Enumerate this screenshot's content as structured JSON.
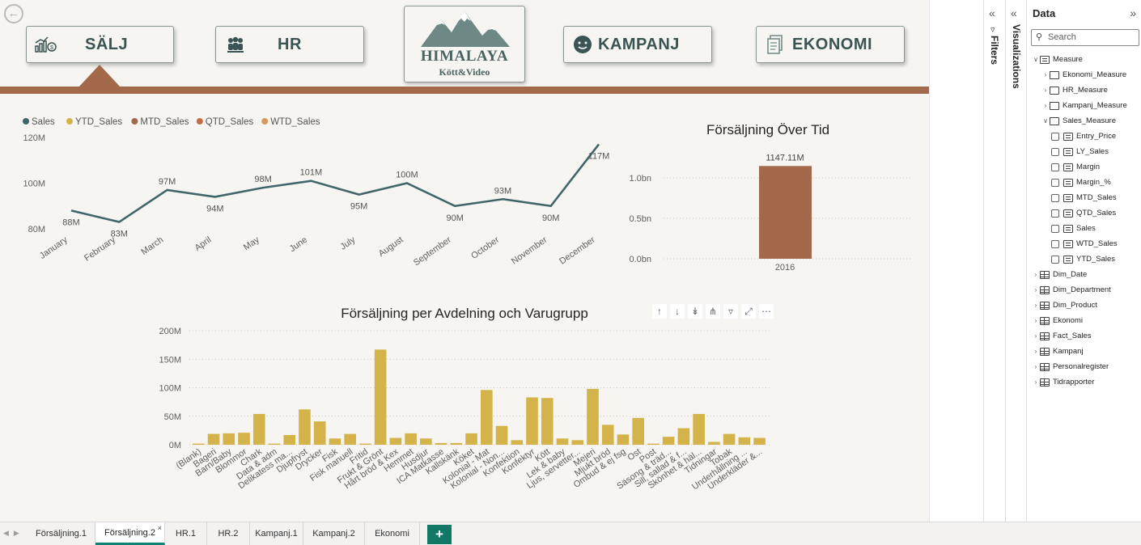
{
  "nav": {
    "salj": "SÄLJ",
    "hr": "HR",
    "kampanj": "KAMPANJ",
    "ekonomi": "EKONOMI"
  },
  "logo": {
    "name": "HIMALAYA",
    "subtitle": "Kött&Video"
  },
  "colors": {
    "accent": "#a4694a",
    "line": "#41666a",
    "bar": "#d4b44a",
    "tab_active": "#118174"
  },
  "legend": [
    {
      "name": "Sales",
      "color": "#41666a"
    },
    {
      "name": "YTD_Sales",
      "color": "#d4b44a"
    },
    {
      "name": "MTD_Sales",
      "color": "#a4694a"
    },
    {
      "name": "QTD_Sales",
      "color": "#c66b45"
    },
    {
      "name": "WTD_Sales",
      "color": "#d39b64"
    }
  ],
  "chart_data": [
    {
      "type": "line",
      "title": "",
      "categories": [
        "January",
        "February",
        "March",
        "April",
        "May",
        "June",
        "July",
        "August",
        "September",
        "October",
        "November",
        "December"
      ],
      "series": [
        {
          "name": "Sales",
          "values": [
            88,
            83,
            97,
            94,
            98,
            101,
            95,
            100,
            90,
            93,
            90,
            117
          ]
        }
      ],
      "data_labels": [
        "88M",
        "83M",
        "97M",
        "94M",
        "98M",
        "101M",
        "95M",
        "100M",
        "90M",
        "93M",
        "90M",
        "117M"
      ],
      "y_ticks": [
        "80M",
        "100M",
        "120M"
      ],
      "ylim": [
        80,
        120
      ],
      "unit": "M"
    },
    {
      "type": "bar",
      "title": "Försäljning Över Tid",
      "categories": [
        "2016"
      ],
      "values": [
        1147.11
      ],
      "data_labels": [
        "1147.11M"
      ],
      "y_ticks": [
        "0.0bn",
        "0.5bn",
        "1.0bn"
      ],
      "ylim": [
        0,
        1.2
      ],
      "unit": "bn"
    },
    {
      "type": "bar",
      "title": "Försäljning per Avdelning och Varugrupp",
      "categories": [
        "(Blank)",
        "Bageri",
        "Barn/Baby",
        "Blommor",
        "Chark",
        "Data & adm",
        "Delikatess ma...",
        "Djupfryst",
        "Drycker",
        "Fisk",
        "Fisk manuell",
        "Fritid",
        "Frukt & Grönt",
        "Hårt bröd & Kex",
        "Hemmet",
        "Husdjur",
        "ICA Matkasse",
        "Kallskänk",
        "Köket",
        "Kolonial - Mat",
        "Kolonial - Non...",
        "Konfektion",
        "Konfektyr",
        "Kött",
        "Lek & baby",
        "Ljus, servetter...",
        "Mejeri",
        "Mjukt bröd",
        "Ombud & ej fsg",
        "Ost",
        "Post",
        "Säsong & träd...",
        "Sill, sallad & f...",
        "Skönhet & häl...",
        "Tidningar",
        "Tobak",
        "Underhållning ...",
        "Underkläder &..."
      ],
      "values": [
        2,
        19,
        20,
        21,
        54,
        2,
        17,
        62,
        41,
        11,
        19,
        2,
        167,
        12,
        20,
        11,
        3,
        3,
        20,
        96,
        33,
        8,
        83,
        82,
        11,
        8,
        98,
        35,
        18,
        47,
        2,
        14,
        29,
        54,
        5,
        19,
        13,
        12
      ],
      "y_ticks": [
        "0M",
        "50M",
        "100M",
        "150M",
        "200M"
      ],
      "ylim": [
        0,
        200
      ],
      "unit": "M"
    }
  ],
  "pane": {
    "filters": "Filters",
    "visualizations": "Visualizations",
    "data_title": "Data",
    "search_placeholder": "Search",
    "tree": [
      {
        "label": "Measure",
        "level": 0,
        "caret": "open",
        "icon": "calc"
      },
      {
        "label": "Ekonomi_Measure",
        "level": 1,
        "caret": "closed",
        "icon": "folder"
      },
      {
        "label": "HR_Measure",
        "level": 1,
        "caret": "closed",
        "icon": "folder"
      },
      {
        "label": "Kampanj_Measure",
        "level": 1,
        "caret": "closed",
        "icon": "folder"
      },
      {
        "label": "Sales_Measure",
        "level": 1,
        "caret": "open",
        "icon": "folder"
      },
      {
        "label": "Entry_Price",
        "level": 2,
        "caret": "none",
        "icon": "calc"
      },
      {
        "label": "LY_Sales",
        "level": 2,
        "caret": "none",
        "icon": "calc"
      },
      {
        "label": "Margin",
        "level": 2,
        "caret": "none",
        "icon": "calc"
      },
      {
        "label": "Margin_%",
        "level": 2,
        "caret": "none",
        "icon": "calc"
      },
      {
        "label": "MTD_Sales",
        "level": 2,
        "caret": "none",
        "icon": "calc"
      },
      {
        "label": "QTD_Sales",
        "level": 2,
        "caret": "none",
        "icon": "calc"
      },
      {
        "label": "Sales",
        "level": 2,
        "caret": "none",
        "icon": "calc"
      },
      {
        "label": "WTD_Sales",
        "level": 2,
        "caret": "none",
        "icon": "calc"
      },
      {
        "label": "YTD_Sales",
        "level": 2,
        "caret": "none",
        "icon": "calc"
      },
      {
        "label": "Dim_Date",
        "level": 0,
        "caret": "closed",
        "icon": "table"
      },
      {
        "label": "Dim_Department",
        "level": 0,
        "caret": "closed",
        "icon": "table"
      },
      {
        "label": "Dim_Product",
        "level": 0,
        "caret": "closed",
        "icon": "table"
      },
      {
        "label": "Ekonomi",
        "level": 0,
        "caret": "closed",
        "icon": "table"
      },
      {
        "label": "Fact_Sales",
        "level": 0,
        "caret": "closed",
        "icon": "table"
      },
      {
        "label": "Kampanj",
        "level": 0,
        "caret": "closed",
        "icon": "table"
      },
      {
        "label": "Personalregister",
        "level": 0,
        "caret": "closed",
        "icon": "table"
      },
      {
        "label": "Tidrapporter",
        "level": 0,
        "caret": "closed",
        "icon": "table"
      }
    ]
  },
  "tabs": [
    {
      "label": "Försäljning.1",
      "active": false
    },
    {
      "label": "Försäljning.2",
      "active": true
    },
    {
      "label": "HR.1",
      "active": false
    },
    {
      "label": "HR.2",
      "active": false
    },
    {
      "label": "Kampanj.1",
      "active": false
    },
    {
      "label": "Kampanj.2",
      "active": false
    },
    {
      "label": "Ekonomi",
      "active": false
    }
  ],
  "add_tab": "+"
}
